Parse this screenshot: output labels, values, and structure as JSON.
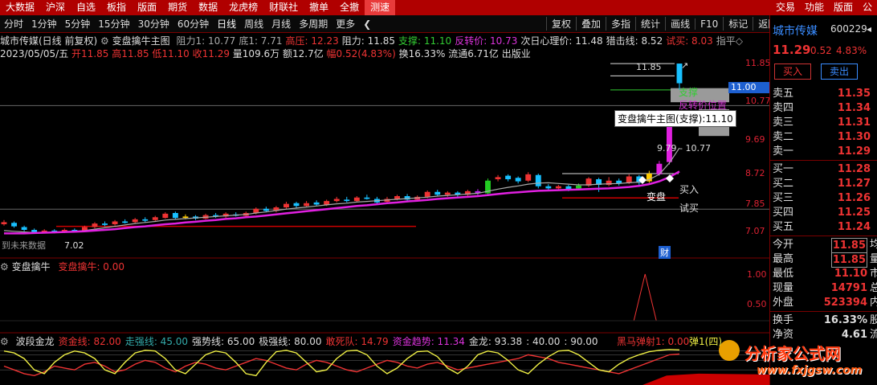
{
  "top_menu": {
    "items": [
      "大数据",
      "沪深",
      "自选",
      "板指",
      "版面",
      "期货",
      "数据",
      "龙虎榜",
      "财联社",
      "撤单",
      "全撤",
      "测速"
    ],
    "active": "测速",
    "right_items": [
      "交易",
      "功能",
      "版面",
      "公"
    ]
  },
  "toolbar": {
    "periods": [
      "分时",
      "1分钟",
      "5分钟",
      "15分钟",
      "30分钟",
      "60分钟",
      "日线",
      "周线",
      "月线",
      "多周期",
      "更多"
    ],
    "more_arrow": "❮",
    "right_buttons": [
      "复权",
      "叠加",
      "多指",
      "统计",
      "画线",
      "F10",
      "标记",
      "返回"
    ]
  },
  "info_line1": {
    "stock": "城市传媒(日线 前复权)",
    "indicator": "变盘擒牛主图",
    "items": [
      {
        "text": "阻力1: 10.77",
        "color": "#aaa"
      },
      {
        "text": "底1: 7.71",
        "color": "#aaa"
      },
      {
        "text": "高压: 12.23",
        "color": "#e33"
      },
      {
        "text": "阻力: 11.85",
        "color": "#ddd"
      },
      {
        "text": "支撑: 11.10",
        "color": "#3c3"
      },
      {
        "text": "反转价: 10.73",
        "color": "#d3d"
      },
      {
        "text": "次日心理价: 11.48",
        "color": "#ddd"
      },
      {
        "text": "猎击线: 8.52",
        "color": "#ddd"
      },
      {
        "text": "试买: 8.03",
        "color": "#e33"
      },
      {
        "text": "指平◇",
        "color": "#aaa"
      }
    ]
  },
  "info_line2": {
    "date": "2023/05/05/五",
    "open": "开11.85",
    "high": "高11.85",
    "low": "低11.10",
    "close": "收11.29",
    "volume": "量109.6万",
    "amount": "额12.7亿",
    "range": "幅0.52(4.83%)",
    "turnover": "换16.33%",
    "float": "流通6.71亿",
    "sector": "出版业"
  },
  "main_axis": [
    "11.85",
    "10.77",
    "9.69",
    "8.72",
    "7.85",
    "7.07"
  ],
  "price_tag": "11.00",
  "tooltip": "变盘擒牛主图(支撑):11.10",
  "annotations": {
    "top_price": "11.85",
    "arrow": "↗",
    "support": "支撑",
    "reversal": "反转价位置",
    "range_label": "9.79 - 10.77",
    "buy": "买入",
    "change": "变盘",
    "try_buy": "试买",
    "low_price": "7.02",
    "left_text": "到未来数据",
    "cai": "财"
  },
  "sub1": {
    "title": "变盘擒牛",
    "label": "变盘擒牛: 0.00",
    "axis": [
      "1.00",
      "0.50"
    ]
  },
  "sub2": {
    "items": [
      {
        "text": "波段金龙",
        "color": "#ddd"
      },
      {
        "text": "资金线: 82.00",
        "color": "#e33"
      },
      {
        "text": "走强线: 45.00",
        "color": "#3aa"
      },
      {
        "text": "强势线: 65.00",
        "color": "#ddd"
      },
      {
        "text": "极强线: 80.00",
        "color": "#ddd"
      },
      {
        "text": "敢死队: 14.79",
        "color": "#e33"
      },
      {
        "text": "资金趋势: 11.34",
        "color": "#d3d"
      },
      {
        "text": "金龙: 93.38",
        "color": "#ddd"
      },
      {
        "text": ": 40.00",
        "color": "#ddd"
      },
      {
        "text": ": 90.00",
        "color": "#ddd"
      }
    ],
    "right_label": "黑马弹射1: 0.00",
    "right_label2": "弹1(四)"
  },
  "quote": {
    "name": "城市传媒",
    "code": "600229",
    "price": "11.29",
    "change": "0.52",
    "pct": "4.83%",
    "buy_btn": "买入",
    "sell_btn": "卖出",
    "asks": [
      {
        "label": "卖五",
        "price": "11.35"
      },
      {
        "label": "卖四",
        "price": "11.34"
      },
      {
        "label": "卖三",
        "price": "11.31"
      },
      {
        "label": "卖二",
        "price": "11.30"
      },
      {
        "label": "卖一",
        "price": "11.29"
      }
    ],
    "bids": [
      {
        "label": "买一",
        "price": "11.28"
      },
      {
        "label": "买二",
        "price": "11.27"
      },
      {
        "label": "买三",
        "price": "11.26"
      },
      {
        "label": "买四",
        "price": "11.25"
      },
      {
        "label": "买五",
        "price": "11.24"
      }
    ],
    "stats": [
      {
        "label": "今开",
        "value": "11.85",
        "boxed": true,
        "extra": "均"
      },
      {
        "label": "最高",
        "value": "11.85",
        "boxed": true,
        "extra": "量"
      },
      {
        "label": "最低",
        "value": "11.10",
        "boxed": false,
        "extra": "市"
      },
      {
        "label": "现量",
        "value": "14791",
        "boxed": false,
        "extra": "总"
      },
      {
        "label": "外盘",
        "value": "523394",
        "boxed": false,
        "extra": "内"
      }
    ],
    "turnover_label": "换手",
    "turnover": "16.33%",
    "turnover_extra": "股",
    "net_label": "净资",
    "net": "4.61",
    "net_extra": "流"
  },
  "watermark": {
    "title": "分析家公式网",
    "url": "www.fxjgsw.com"
  },
  "colors": {
    "up": "#e33",
    "down": "#18c0ff",
    "ma_magenta": "#e020e0",
    "ma_gray": "#aaaaaa",
    "menu_red": "#b00000"
  },
  "chart_data": {
    "type": "candlestick",
    "price_range": [
      6.8,
      12.4
    ],
    "candles": [
      {
        "o": 7.28,
        "c": 7.34,
        "h": 7.4,
        "l": 7.24
      },
      {
        "o": 7.32,
        "c": 7.22,
        "h": 7.36,
        "l": 7.18
      },
      {
        "o": 7.2,
        "c": 7.12,
        "h": 7.24,
        "l": 7.08
      },
      {
        "o": 7.12,
        "c": 7.04,
        "h": 7.16,
        "l": 7.02
      },
      {
        "o": 7.05,
        "c": 7.1,
        "h": 7.14,
        "l": 7.02
      },
      {
        "o": 7.1,
        "c": 7.05,
        "h": 7.14,
        "l": 7.02
      },
      {
        "o": 7.06,
        "c": 7.12,
        "h": 7.16,
        "l": 7.03
      },
      {
        "o": 7.12,
        "c": 7.08,
        "h": 7.16,
        "l": 7.05
      },
      {
        "o": 7.1,
        "c": 7.2,
        "h": 7.24,
        "l": 7.08
      },
      {
        "o": 7.2,
        "c": 7.3,
        "h": 7.34,
        "l": 7.16
      },
      {
        "o": 7.3,
        "c": 7.26,
        "h": 7.36,
        "l": 7.22
      },
      {
        "o": 7.28,
        "c": 7.36,
        "h": 7.4,
        "l": 7.24
      },
      {
        "o": 7.36,
        "c": 7.32,
        "h": 7.42,
        "l": 7.3
      },
      {
        "o": 7.34,
        "c": 7.42,
        "h": 7.46,
        "l": 7.3
      },
      {
        "o": 7.42,
        "c": 7.38,
        "h": 7.48,
        "l": 7.34
      },
      {
        "o": 7.4,
        "c": 7.48,
        "h": 7.52,
        "l": 7.36
      },
      {
        "o": 7.46,
        "c": 7.58,
        "h": 7.62,
        "l": 7.44
      },
      {
        "o": 7.6,
        "c": 7.46,
        "h": 7.64,
        "l": 7.42
      },
      {
        "o": 7.46,
        "c": 7.5,
        "h": 7.56,
        "l": 7.42
      },
      {
        "o": 7.5,
        "c": 7.44,
        "h": 7.54,
        "l": 7.4
      },
      {
        "o": 7.44,
        "c": 7.54,
        "h": 7.58,
        "l": 7.42
      },
      {
        "o": 7.54,
        "c": 7.5,
        "h": 7.6,
        "l": 7.46
      },
      {
        "o": 7.5,
        "c": 7.58,
        "h": 7.62,
        "l": 7.46
      },
      {
        "o": 7.56,
        "c": 7.52,
        "h": 7.62,
        "l": 7.5
      },
      {
        "o": 7.52,
        "c": 7.6,
        "h": 7.64,
        "l": 7.48
      },
      {
        "o": 7.6,
        "c": 7.72,
        "h": 7.76,
        "l": 7.56
      },
      {
        "o": 7.72,
        "c": 7.66,
        "h": 7.78,
        "l": 7.62
      },
      {
        "o": 7.66,
        "c": 7.76,
        "h": 7.8,
        "l": 7.62
      },
      {
        "o": 7.76,
        "c": 7.86,
        "h": 7.92,
        "l": 7.72
      },
      {
        "o": 7.88,
        "c": 7.8,
        "h": 7.92,
        "l": 7.74
      },
      {
        "o": 7.8,
        "c": 7.88,
        "h": 7.94,
        "l": 7.76
      },
      {
        "o": 7.9,
        "c": 7.84,
        "h": 7.96,
        "l": 7.8
      },
      {
        "o": 7.84,
        "c": 7.94,
        "h": 7.98,
        "l": 7.8
      },
      {
        "o": 7.94,
        "c": 8.0,
        "h": 8.06,
        "l": 7.9
      },
      {
        "o": 7.98,
        "c": 7.94,
        "h": 8.06,
        "l": 7.9
      },
      {
        "o": 7.94,
        "c": 8.04,
        "h": 8.08,
        "l": 7.9
      },
      {
        "o": 8.04,
        "c": 8.0,
        "h": 8.12,
        "l": 7.98
      },
      {
        "o": 8.0,
        "c": 7.9,
        "h": 8.06,
        "l": 7.86
      },
      {
        "o": 7.92,
        "c": 8.0,
        "h": 8.06,
        "l": 7.88
      },
      {
        "o": 8.0,
        "c": 8.08,
        "h": 8.12,
        "l": 7.96
      },
      {
        "o": 8.08,
        "c": 7.98,
        "h": 8.14,
        "l": 7.94
      },
      {
        "o": 7.98,
        "c": 8.06,
        "h": 8.1,
        "l": 7.94
      },
      {
        "o": 8.06,
        "c": 8.2,
        "h": 8.24,
        "l": 8.02
      },
      {
        "o": 8.2,
        "c": 8.12,
        "h": 8.26,
        "l": 8.08
      },
      {
        "o": 8.12,
        "c": 8.18,
        "h": 8.22,
        "l": 8.06
      },
      {
        "o": 8.18,
        "c": 8.12,
        "h": 8.22,
        "l": 8.06
      },
      {
        "o": 8.12,
        "c": 8.22,
        "h": 8.26,
        "l": 8.08
      },
      {
        "o": 8.22,
        "c": 8.16,
        "h": 8.28,
        "l": 8.1
      },
      {
        "o": 8.16,
        "c": 8.52,
        "h": 8.58,
        "l": 8.12
      },
      {
        "o": 8.56,
        "c": 8.62,
        "h": 8.68,
        "l": 8.5
      },
      {
        "o": 8.66,
        "c": 8.56,
        "h": 8.7,
        "l": 8.5
      },
      {
        "o": 8.6,
        "c": 8.5,
        "h": 8.64,
        "l": 8.44
      },
      {
        "o": 8.52,
        "c": 8.7,
        "h": 8.76,
        "l": 8.48
      },
      {
        "o": 8.68,
        "c": 8.36,
        "h": 8.72,
        "l": 8.3
      },
      {
        "o": 8.36,
        "c": 8.3,
        "h": 8.42,
        "l": 8.24
      },
      {
        "o": 8.3,
        "c": 8.36,
        "h": 8.4,
        "l": 8.26
      },
      {
        "o": 8.36,
        "c": 8.28,
        "h": 8.4,
        "l": 8.22
      },
      {
        "o": 8.3,
        "c": 8.38,
        "h": 8.44,
        "l": 8.26
      },
      {
        "o": 8.38,
        "c": 8.58,
        "h": 8.62,
        "l": 8.34
      },
      {
        "o": 8.56,
        "c": 8.4,
        "h": 8.6,
        "l": 8.2
      },
      {
        "o": 8.4,
        "c": 8.52,
        "h": 8.62,
        "l": 8.36
      },
      {
        "o": 8.52,
        "c": 8.44,
        "h": 8.58,
        "l": 8.38
      },
      {
        "o": 8.46,
        "c": 8.64,
        "h": 8.7,
        "l": 8.42
      },
      {
        "o": 8.64,
        "c": 8.46,
        "h": 8.68,
        "l": 8.4
      },
      {
        "o": 8.5,
        "c": 8.72,
        "h": 8.8,
        "l": 8.46
      },
      {
        "o": 8.7,
        "c": 9.0,
        "h": 9.08,
        "l": 8.66
      },
      {
        "o": 9.05,
        "c": 10.1,
        "h": 10.12,
        "l": 8.98
      },
      {
        "o": 11.85,
        "c": 11.29,
        "h": 11.85,
        "l": 11.1
      }
    ],
    "ma_magenta": [
      7.02,
      7.02,
      7.02,
      7.03,
      7.04,
      7.05,
      7.06,
      7.07,
      7.08,
      7.1,
      7.12,
      7.14,
      7.17,
      7.2,
      7.22,
      7.25,
      7.28,
      7.3,
      7.33,
      7.35,
      7.38,
      7.4,
      7.43,
      7.45,
      7.48,
      7.5,
      7.53,
      7.56,
      7.59,
      7.62,
      7.65,
      7.68,
      7.71,
      7.74,
      7.77,
      7.8,
      7.82,
      7.85,
      7.88,
      7.9,
      7.93,
      7.95,
      7.97,
      8.0,
      8.02,
      8.04,
      8.06,
      8.08,
      8.11,
      8.14,
      8.17,
      8.19,
      8.21,
      8.23,
      8.24,
      8.25,
      8.26,
      8.27,
      8.28,
      8.29,
      8.3,
      8.32,
      8.34,
      8.37,
      8.42,
      8.5,
      8.62,
      8.78
    ],
    "ma_gray": [
      7.1,
      7.08,
      7.06,
      7.04,
      7.04,
      7.05,
      7.06,
      7.08,
      7.1,
      7.14,
      7.18,
      7.22,
      7.26,
      7.3,
      7.33,
      7.36,
      7.4,
      7.42,
      7.44,
      7.46,
      7.48,
      7.5,
      7.52,
      7.54,
      7.56,
      7.6,
      7.63,
      7.67,
      7.71,
      7.74,
      7.77,
      7.8,
      7.83,
      7.86,
      7.88,
      7.91,
      7.93,
      7.95,
      7.97,
      7.99,
      8.01,
      8.03,
      8.05,
      8.08,
      8.1,
      8.12,
      8.14,
      8.16,
      8.22,
      8.28,
      8.33,
      8.37,
      8.42,
      8.45,
      8.46,
      8.44,
      8.42,
      8.4,
      8.4,
      8.42,
      8.43,
      8.44,
      8.46,
      8.48,
      8.55,
      8.7,
      9.02,
      9.45
    ],
    "sub1_peak_index": 62,
    "sub2_series": [
      {
        "name": "资金线",
        "color": "#e33",
        "values": [
          50,
          40,
          30,
          25,
          35,
          50,
          45,
          40,
          55,
          60,
          50,
          35,
          40,
          55,
          65,
          60,
          45,
          35,
          50,
          60,
          55,
          45,
          40,
          50,
          60,
          70,
          65,
          55,
          45,
          40,
          55,
          65,
          60,
          50,
          40,
          35,
          45,
          55,
          65,
          60,
          50,
          45,
          55,
          60,
          50,
          40,
          45,
          50,
          55,
          60,
          65,
          70,
          80,
          75,
          70,
          60,
          55,
          50,
          45,
          40,
          35,
          30,
          40,
          50,
          60,
          70,
          80,
          82
        ]
      },
      {
        "name": "金龙",
        "color": "#ee4",
        "values": [
          90,
          85,
          70,
          40,
          30,
          60,
          80,
          90,
          85,
          70,
          40,
          30,
          60,
          85,
          92,
          90,
          70,
          40,
          30,
          55,
          80,
          90,
          85,
          60,
          30,
          25,
          60,
          88,
          92,
          85,
          60,
          35,
          40,
          70,
          90,
          92,
          80,
          50,
          30,
          45,
          70,
          88,
          90,
          75,
          45,
          30,
          50,
          80,
          90,
          85,
          65,
          40,
          30,
          55,
          75,
          90,
          92,
          80,
          60,
          40,
          35,
          55,
          70,
          80,
          88,
          92,
          94,
          93
        ]
      }
    ]
  }
}
